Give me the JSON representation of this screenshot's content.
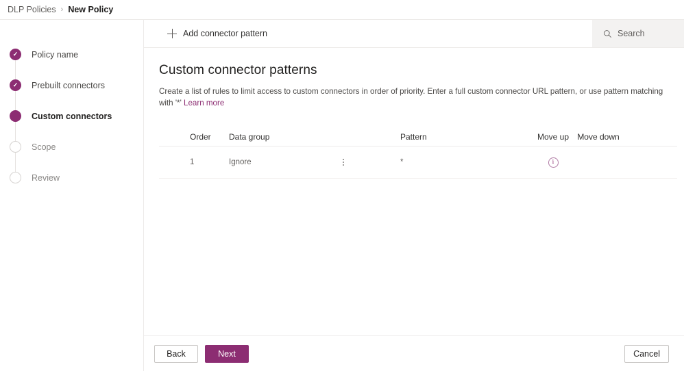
{
  "breadcrumb": {
    "parent": "DLP Policies",
    "separator": "›",
    "current": "New Policy"
  },
  "sidebar": {
    "steps": [
      {
        "label": "Policy name",
        "state": "done"
      },
      {
        "label": "Prebuilt connectors",
        "state": "done"
      },
      {
        "label": "Custom connectors",
        "state": "current"
      },
      {
        "label": "Scope",
        "state": "todo"
      },
      {
        "label": "Review",
        "state": "todo"
      }
    ],
    "check_glyph": "✓"
  },
  "commandbar": {
    "add_label": "Add connector pattern",
    "add_icon": "plus-icon"
  },
  "search": {
    "placeholder": "Search",
    "icon": "search-icon"
  },
  "main": {
    "title": "Custom connector patterns",
    "description_part1": "Create a list of rules to limit access to custom connectors in order of priority. Enter a full custom connector URL pattern, or use pattern matching with '*' ",
    "learn_more": "Learn more"
  },
  "table": {
    "columns": {
      "order": "Order",
      "data_group": "Data group",
      "pattern": "Pattern",
      "move_up": "Move up",
      "move_down": "Move down"
    },
    "rows": [
      {
        "order": "1",
        "data_group": "Ignore",
        "pattern": "*",
        "group_menu_icon": "kebab-menu-icon",
        "move_up_icon": "info-circle-icon",
        "move_down": ""
      }
    ]
  },
  "footer": {
    "back": "Back",
    "next": "Next",
    "cancel": "Cancel"
  },
  "colors": {
    "accent": "#8c2d72",
    "text": "#323130",
    "muted": "#605e5c",
    "border": "#edebe9",
    "search_bg": "#f3f2f1"
  }
}
